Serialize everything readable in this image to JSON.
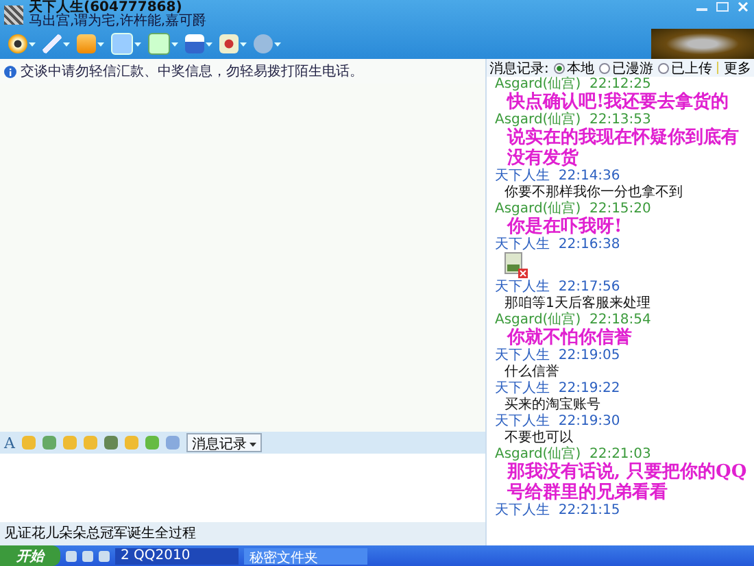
{
  "window": {
    "title": "天下人生(604777868)",
    "subtitle": "马出宫,谓为宅,许杵能,嘉可爵"
  },
  "notice": "交谈中请勿轻信汇款、中奖信息，勿轻易拨打陌生电话。",
  "history": {
    "label": "消息记录:",
    "options": [
      {
        "label": "本地",
        "selected": true
      },
      {
        "label": "已漫游",
        "selected": false
      },
      {
        "label": "已上传",
        "selected": false
      }
    ],
    "more": "更多",
    "messages": [
      {
        "sender": "Asgard(仙宫)",
        "time": "22:12:25",
        "color": "#3a9a3a",
        "kind": "big",
        "text": "快点确认吧!我还要去拿货的"
      },
      {
        "sender": "Asgard(仙宫)",
        "time": "22:13:53",
        "color": "#3a9a3a",
        "kind": "big",
        "text": "说实在的我现在怀疑你到底有没有发货"
      },
      {
        "sender": "天下人生",
        "time": "22:14:36",
        "color": "#2b5fc0",
        "kind": "small",
        "text": "你要不那样我你一分也拿不到"
      },
      {
        "sender": "Asgard(仙宫)",
        "time": "22:15:20",
        "color": "#3a9a3a",
        "kind": "big",
        "text": "你是在吓我呀!"
      },
      {
        "sender": "天下人生",
        "time": "22:16:38",
        "color": "#2b5fc0",
        "kind": "image"
      },
      {
        "sender": "天下人生",
        "time": "22:17:56",
        "color": "#2b5fc0",
        "kind": "small",
        "text": "那咱等1天后客服来处理"
      },
      {
        "sender": "Asgard(仙宫)",
        "time": "22:18:54",
        "color": "#3a9a3a",
        "kind": "big",
        "text": "你就不怕你信誉"
      },
      {
        "sender": "天下人生",
        "time": "22:19:05",
        "color": "#2b5fc0",
        "kind": "small",
        "text": "什么信誉"
      },
      {
        "sender": "天下人生",
        "time": "22:19:22",
        "color": "#2b5fc0",
        "kind": "small",
        "text": "买来的淘宝账号"
      },
      {
        "sender": "天下人生",
        "time": "22:19:30",
        "color": "#2b5fc0",
        "kind": "small",
        "text": "不要也可以"
      },
      {
        "sender": "Asgard(仙宫)",
        "time": "22:21:03",
        "color": "#3a9a3a",
        "kind": "big",
        "text": "那我没有话说, 只要把你的QQ号给群里的兄弟看看"
      },
      {
        "sender": "天下人生",
        "time": "22:21:15",
        "color": "#2b5fc0",
        "kind": "empty"
      }
    ]
  },
  "input_toolbar": {
    "font_key": "A",
    "history_button": "消息记录"
  },
  "status_bar": "见证花儿朵朵总冠军诞生全过程",
  "taskbar": {
    "start": "开始",
    "tasks": [
      {
        "label": "2 QQ2010",
        "selected": true
      },
      {
        "label": "秘密文件夹",
        "selected": false
      }
    ]
  }
}
